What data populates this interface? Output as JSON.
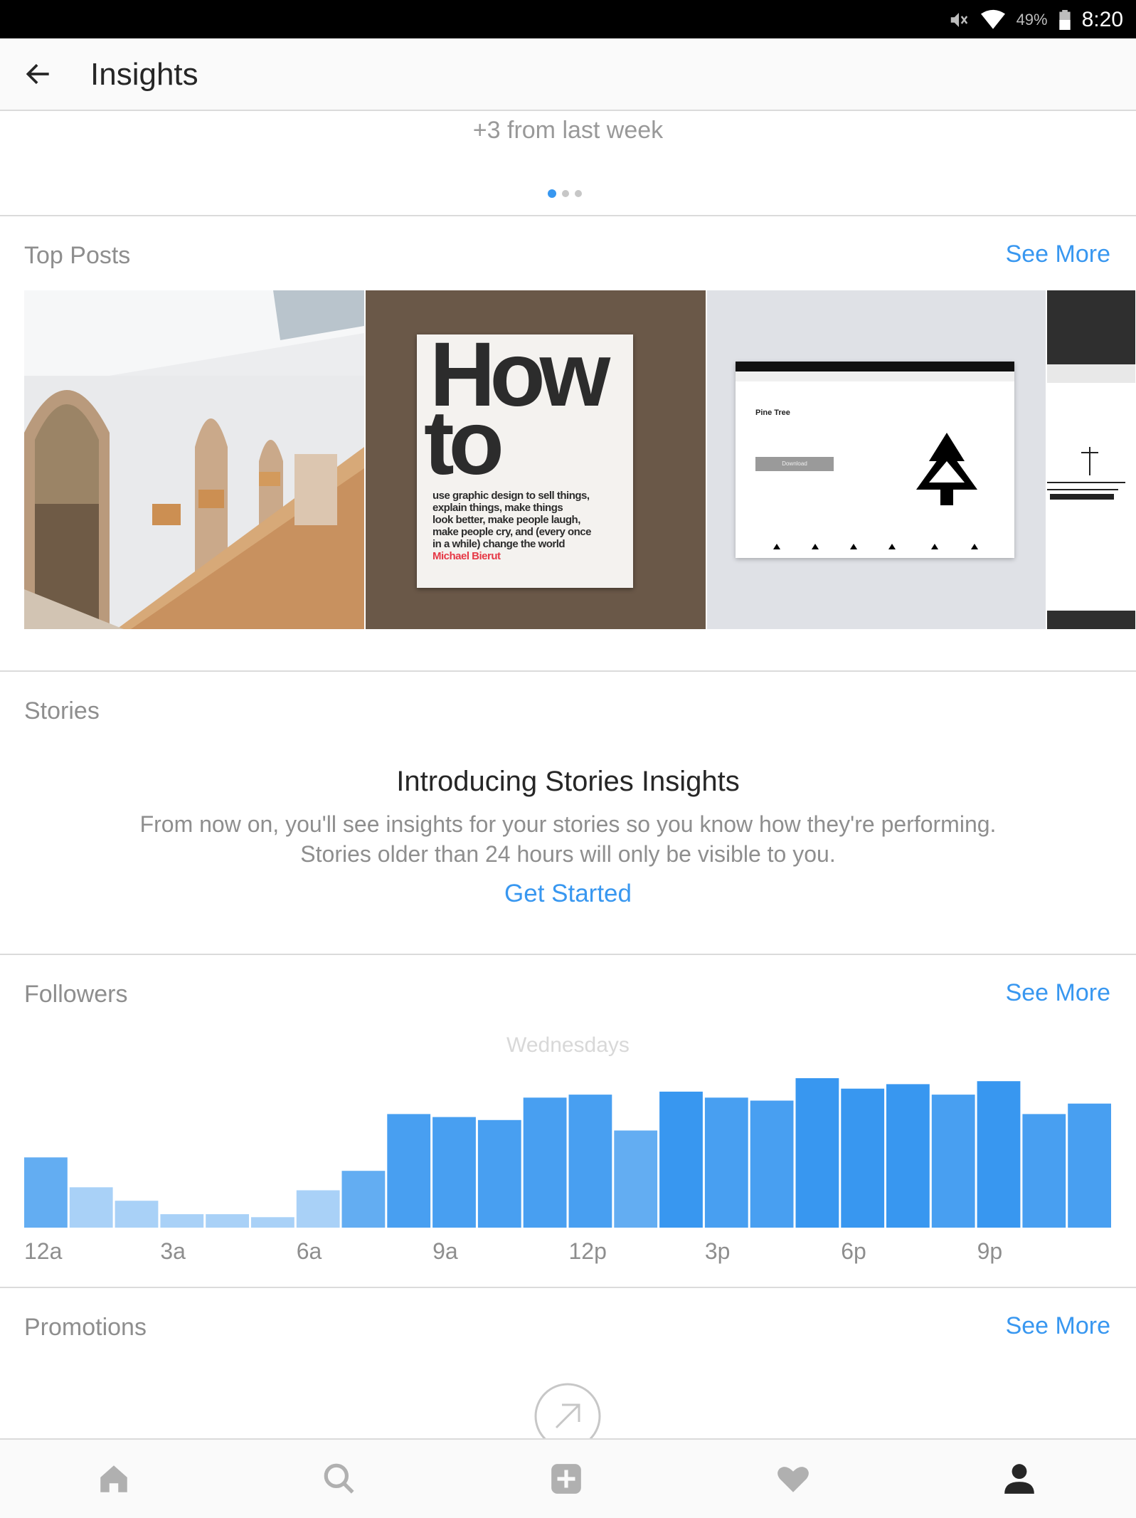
{
  "status_bar": {
    "battery_percent": "49%",
    "time": "8:20"
  },
  "header": {
    "title": "Insights"
  },
  "summary": {
    "change_text": "+3 from last week",
    "carousel_dots": 3,
    "active_dot": 0
  },
  "top_posts": {
    "label": "Top Posts",
    "see_more": "See More",
    "book": {
      "title_line1": "How",
      "title_line2": "to",
      "body": [
        "use graphic design to sell things,",
        "explain things, make things",
        "look better, make people laugh,",
        "make people cry, and (every once",
        "in a while) change the world"
      ],
      "author": "Michael Bierut"
    },
    "screenshot_post": {
      "heading": "Pine Tree",
      "button": "Download"
    }
  },
  "stories": {
    "label": "Stories",
    "heading": "Introducing Stories Insights",
    "body_line1": "From now on, you'll see insights for your stories so you know how they're performing.",
    "body_line2": "Stories older than 24 hours will only be visible to you.",
    "cta": "Get Started"
  },
  "followers": {
    "label": "Followers",
    "see_more": "See More",
    "caption": "Wednesdays"
  },
  "chart_data": {
    "type": "bar",
    "title": "Wednesdays",
    "categories": [
      "12a",
      "1a",
      "2a",
      "3a",
      "4a",
      "5a",
      "6a",
      "7a",
      "8a",
      "9a",
      "10a",
      "11a",
      "12p",
      "1p",
      "2p",
      "3p",
      "4p",
      "5p",
      "6p",
      "7p",
      "8p",
      "9p",
      "10p",
      "11p"
    ],
    "values": [
      47,
      27,
      18,
      9,
      9,
      7,
      25,
      38,
      76,
      74,
      72,
      87,
      89,
      65,
      91,
      87,
      85,
      100,
      93,
      96,
      89,
      98,
      76,
      83
    ],
    "tick_labels": [
      "12a",
      "3a",
      "6a",
      "9a",
      "12p",
      "3p",
      "6p",
      "9p"
    ],
    "ylim": [
      0,
      100
    ],
    "colors": {
      "low": "#a9d1f7",
      "mid": "#63adf2",
      "high": "#3897f0"
    }
  },
  "promotions": {
    "label": "Promotions",
    "see_more": "See More"
  },
  "nav": [
    "home-icon",
    "search-icon",
    "add-post-icon",
    "heart-icon",
    "profile-icon"
  ]
}
